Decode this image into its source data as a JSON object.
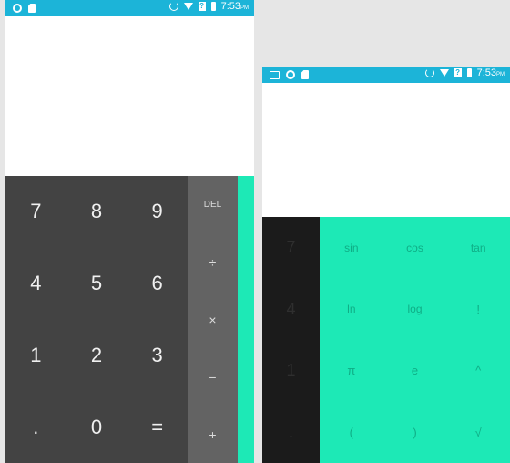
{
  "left_phone": {
    "statusbar": {
      "left_icons": [
        "ring-icon",
        "sim-card-icon"
      ],
      "right_icons": [
        "sync-icon",
        "wifi-icon",
        "sim-signal-icon",
        "battery-icon"
      ],
      "time": "7:53",
      "ampm": "PM"
    },
    "numpad": [
      [
        "7",
        "8",
        "9"
      ],
      [
        "4",
        "5",
        "6"
      ],
      [
        "1",
        "2",
        "3"
      ],
      [
        ".",
        "0",
        "="
      ]
    ],
    "operators": [
      "DEL",
      "÷",
      "×",
      "−",
      "+"
    ]
  },
  "right_phone": {
    "statusbar": {
      "left_icons": [
        "image-icon",
        "ring-icon",
        "sim-card-icon"
      ],
      "right_icons": [
        "sync-icon",
        "wifi-icon",
        "sim-signal-icon",
        "battery-icon"
      ],
      "time": "7:53",
      "ampm": "PM"
    },
    "numpad_visible": [
      "7",
      "4",
      "1",
      "."
    ],
    "advanced": [
      [
        "sin",
        "cos",
        "tan"
      ],
      [
        "ln",
        "log",
        "!"
      ],
      [
        "π",
        "e",
        "^"
      ],
      [
        "(",
        ")",
        "√"
      ]
    ]
  },
  "colors": {
    "statusbar": "#1cb4d8",
    "numpad": "#434343",
    "operators": "#636363",
    "advanced": "#1de9b6"
  }
}
